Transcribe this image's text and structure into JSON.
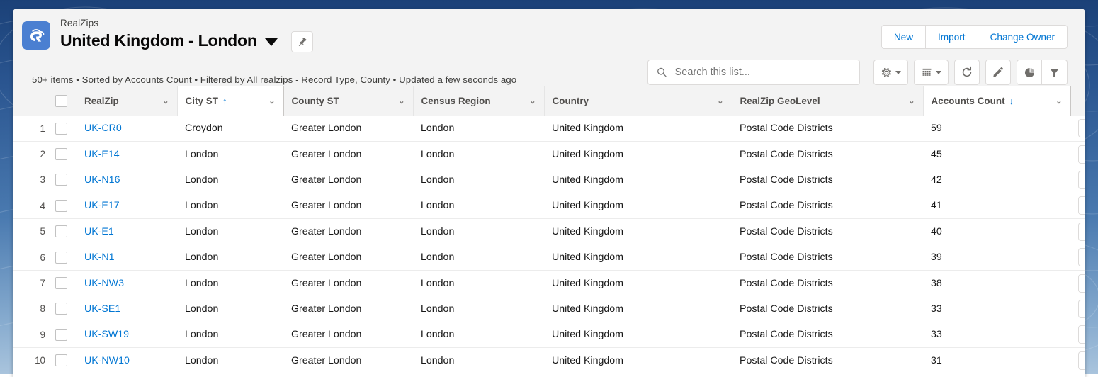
{
  "header": {
    "app_name": "RealZips",
    "list_title": "United Kingdom - London",
    "app_icon": "realzips-cloud-r-icon",
    "title_caret_icon": "chevron-down-icon",
    "pin_icon": "pin-icon",
    "meta_text": "50+ items • Sorted by Accounts Count • Filtered by All realzips - Record Type, County • Updated a few seconds ago",
    "actions": [
      {
        "label": "New",
        "name": "new-button"
      },
      {
        "label": "Import",
        "name": "import-button"
      },
      {
        "label": "Change Owner",
        "name": "change-owner-button"
      }
    ]
  },
  "search": {
    "placeholder": "Search this list...",
    "value": "",
    "icon": "search-icon"
  },
  "toolbar_icons": [
    {
      "name": "list-view-controls-icon",
      "glyph": "gear-icon",
      "has_caret": true
    },
    {
      "name": "display-as-icon",
      "glyph": "table-icon",
      "has_caret": true
    },
    {
      "name": "refresh-button",
      "glyph": "refresh-icon",
      "has_caret": false
    },
    {
      "name": "edit-button",
      "glyph": "pencil-icon",
      "has_caret": false
    },
    {
      "name": "charts-button",
      "glyph": "pie-chart-icon",
      "has_caret": false
    },
    {
      "name": "filter-button",
      "glyph": "funnel-icon",
      "has_caret": false
    }
  ],
  "table": {
    "columns": [
      {
        "label": "RealZip",
        "name": "column-realzip",
        "sort": null,
        "key": "realzip"
      },
      {
        "label": "City ST",
        "name": "column-city-st",
        "sort": "asc",
        "key": "city"
      },
      {
        "label": "County ST",
        "name": "column-county-st",
        "sort": null,
        "key": "county"
      },
      {
        "label": "Census Region",
        "name": "column-census-region",
        "sort": null,
        "key": "census"
      },
      {
        "label": "Country",
        "name": "column-country",
        "sort": null,
        "key": "country"
      },
      {
        "label": "RealZip GeoLevel",
        "name": "column-realzip-geolevel",
        "sort": null,
        "key": "geolevel"
      },
      {
        "label": "Accounts Count",
        "name": "column-accounts-count",
        "sort": "desc",
        "key": "accounts"
      }
    ],
    "sort_asc_glyph": "↑",
    "sort_desc_glyph": "↓",
    "rows": [
      {
        "n": "1",
        "realzip": "UK-CR0",
        "city": "Croydon",
        "county": "Greater London",
        "census": "London",
        "country": "United Kingdom",
        "geolevel": "Postal Code Districts",
        "accounts": "59"
      },
      {
        "n": "2",
        "realzip": "UK-E14",
        "city": "London",
        "county": "Greater London",
        "census": "London",
        "country": "United Kingdom",
        "geolevel": "Postal Code Districts",
        "accounts": "45"
      },
      {
        "n": "3",
        "realzip": "UK-N16",
        "city": "London",
        "county": "Greater London",
        "census": "London",
        "country": "United Kingdom",
        "geolevel": "Postal Code Districts",
        "accounts": "42"
      },
      {
        "n": "4",
        "realzip": "UK-E17",
        "city": "London",
        "county": "Greater London",
        "census": "London",
        "country": "United Kingdom",
        "geolevel": "Postal Code Districts",
        "accounts": "41"
      },
      {
        "n": "5",
        "realzip": "UK-E1",
        "city": "London",
        "county": "Greater London",
        "census": "London",
        "country": "United Kingdom",
        "geolevel": "Postal Code Districts",
        "accounts": "40"
      },
      {
        "n": "6",
        "realzip": "UK-N1",
        "city": "London",
        "county": "Greater London",
        "census": "London",
        "country": "United Kingdom",
        "geolevel": "Postal Code Districts",
        "accounts": "39"
      },
      {
        "n": "7",
        "realzip": "UK-NW3",
        "city": "London",
        "county": "Greater London",
        "census": "London",
        "country": "United Kingdom",
        "geolevel": "Postal Code Districts",
        "accounts": "38"
      },
      {
        "n": "8",
        "realzip": "UK-SE1",
        "city": "London",
        "county": "Greater London",
        "census": "London",
        "country": "United Kingdom",
        "geolevel": "Postal Code Districts",
        "accounts": "33"
      },
      {
        "n": "9",
        "realzip": "UK-SW19",
        "city": "London",
        "county": "Greater London",
        "census": "London",
        "country": "United Kingdom",
        "geolevel": "Postal Code Districts",
        "accounts": "33"
      },
      {
        "n": "10",
        "realzip": "UK-NW10",
        "city": "London",
        "county": "Greater London",
        "census": "London",
        "country": "United Kingdom",
        "geolevel": "Postal Code Districts",
        "accounts": "31"
      }
    ]
  },
  "colors": {
    "link": "#0176d3",
    "brand_blue": "#4a7fd1",
    "header_bg": "#f3f3f3",
    "page_bg": "#2a5590"
  }
}
